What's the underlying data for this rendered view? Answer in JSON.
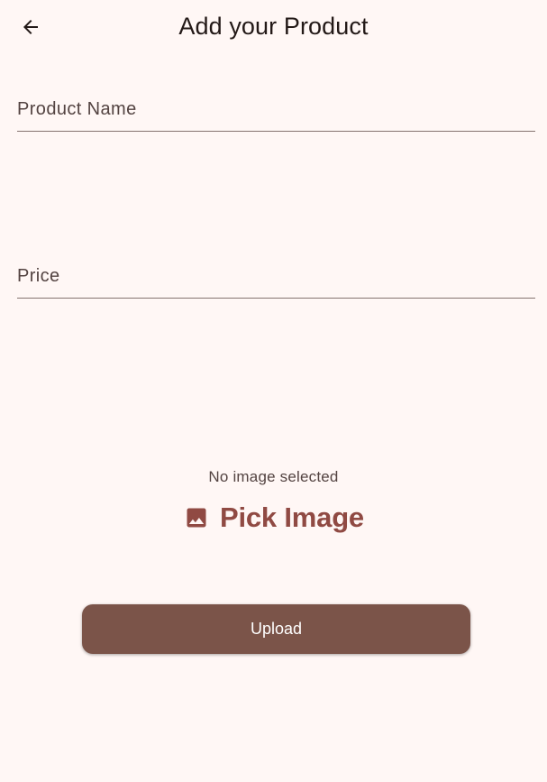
{
  "app_bar": {
    "title": "Add your Product",
    "back_icon": "arrow-back-icon"
  },
  "form": {
    "product_name": {
      "placeholder": "Product Name",
      "value": ""
    },
    "price": {
      "placeholder": "Price",
      "value": ""
    }
  },
  "image_picker": {
    "status": "No image selected",
    "button_label": "Pick Image",
    "icon": "image-icon"
  },
  "upload": {
    "label": "Upload"
  },
  "colors": {
    "background": "#fff7f5",
    "primary": "#904a43",
    "upload_button": "#7b5449",
    "underline": "#857370"
  }
}
